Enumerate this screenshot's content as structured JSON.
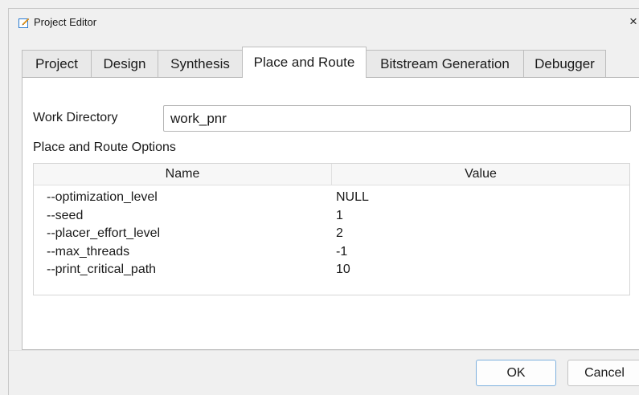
{
  "window": {
    "title": "Project Editor",
    "close_glyph": "×"
  },
  "tabs": [
    {
      "label": "Project",
      "active": false
    },
    {
      "label": "Design",
      "active": false
    },
    {
      "label": "Synthesis",
      "active": false
    },
    {
      "label": "Place and Route",
      "active": true
    },
    {
      "label": "Bitstream Generation",
      "active": false
    },
    {
      "label": "Debugger",
      "active": false
    }
  ],
  "work_directory": {
    "label": "Work Directory",
    "value": "work_pnr"
  },
  "options": {
    "label": "Place and Route Options",
    "columns": [
      "Name",
      "Value"
    ],
    "rows": [
      {
        "name": "--optimization_level",
        "value": "NULL"
      },
      {
        "name": "--seed",
        "value": "1"
      },
      {
        "name": "--placer_effort_level",
        "value": "2"
      },
      {
        "name": "--max_threads",
        "value": "-1"
      },
      {
        "name": "--print_critical_path",
        "value": "10"
      }
    ]
  },
  "buttons": {
    "ok": "OK",
    "cancel": "Cancel"
  },
  "colors": {
    "tab_active_bg": "#ffffff",
    "tab_inactive_bg": "#e9e9e9",
    "ok_border": "#7eb0de"
  }
}
